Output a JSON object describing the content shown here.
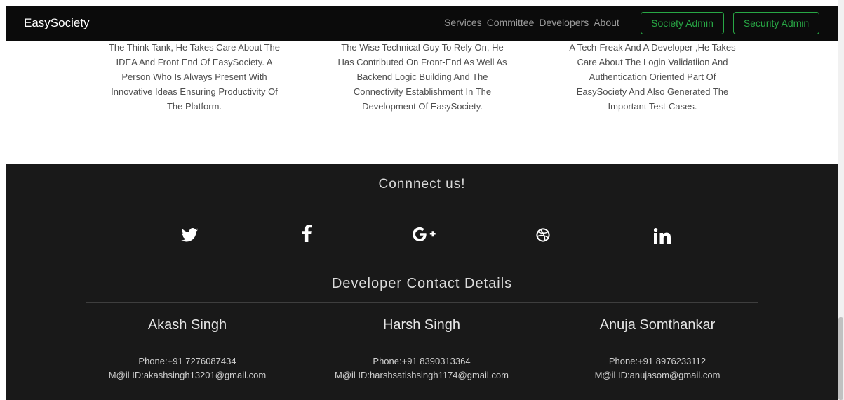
{
  "navbar": {
    "brand": "EasySociety",
    "links": [
      "Services",
      "Committee",
      "Developers",
      "About"
    ],
    "society_admin_label": "Society Admin",
    "security_admin_label": "Security Admin"
  },
  "developer_descriptions": [
    [
      "The Think Tank, He Takes Care About The",
      "IDEA And Front End Of EasySociety. A",
      "Person Who Is Always Present With",
      "Innovative Ideas Ensuring Productivity Of",
      "The Platform."
    ],
    [
      "The Wise Technical Guy To Rely On, He",
      "Has Contributed On Front-End As Well As",
      "Backend Logic Building And The",
      "Connectivity Establishment In The",
      "Development Of EasySociety."
    ],
    [
      "A Tech-Freak And A Developer ,He Takes",
      "Care About The Login Validatiion And",
      "Authentication Oriented Part Of",
      "EasySociety And Also Generated The",
      "Important Test-Cases."
    ]
  ],
  "footer": {
    "connect_title": "Connnect us!",
    "social_icons": [
      "twitter-icon",
      "facebook-icon",
      "google-plus-icon",
      "dribbble-icon",
      "linkedin-icon"
    ],
    "contact_title": "Developer Contact Details",
    "developers": [
      {
        "name": "Akash Singh",
        "phone": "Phone:+91 7276087434",
        "email": "M@il ID:akashsingh13201@gmail.com"
      },
      {
        "name": "Harsh Singh",
        "phone": "Phone:+91 8390313364",
        "email": "M@il ID:harshsatishsingh1174@gmail.com"
      },
      {
        "name": "Anuja Somthankar",
        "phone": "Phone:+91 8976233112",
        "email": "M@il ID:anujasom@gmail.com"
      }
    ]
  },
  "colors": {
    "footer_bg": "#191919",
    "navbar_bg": "#0b0b0b",
    "accent": "#28a745"
  }
}
